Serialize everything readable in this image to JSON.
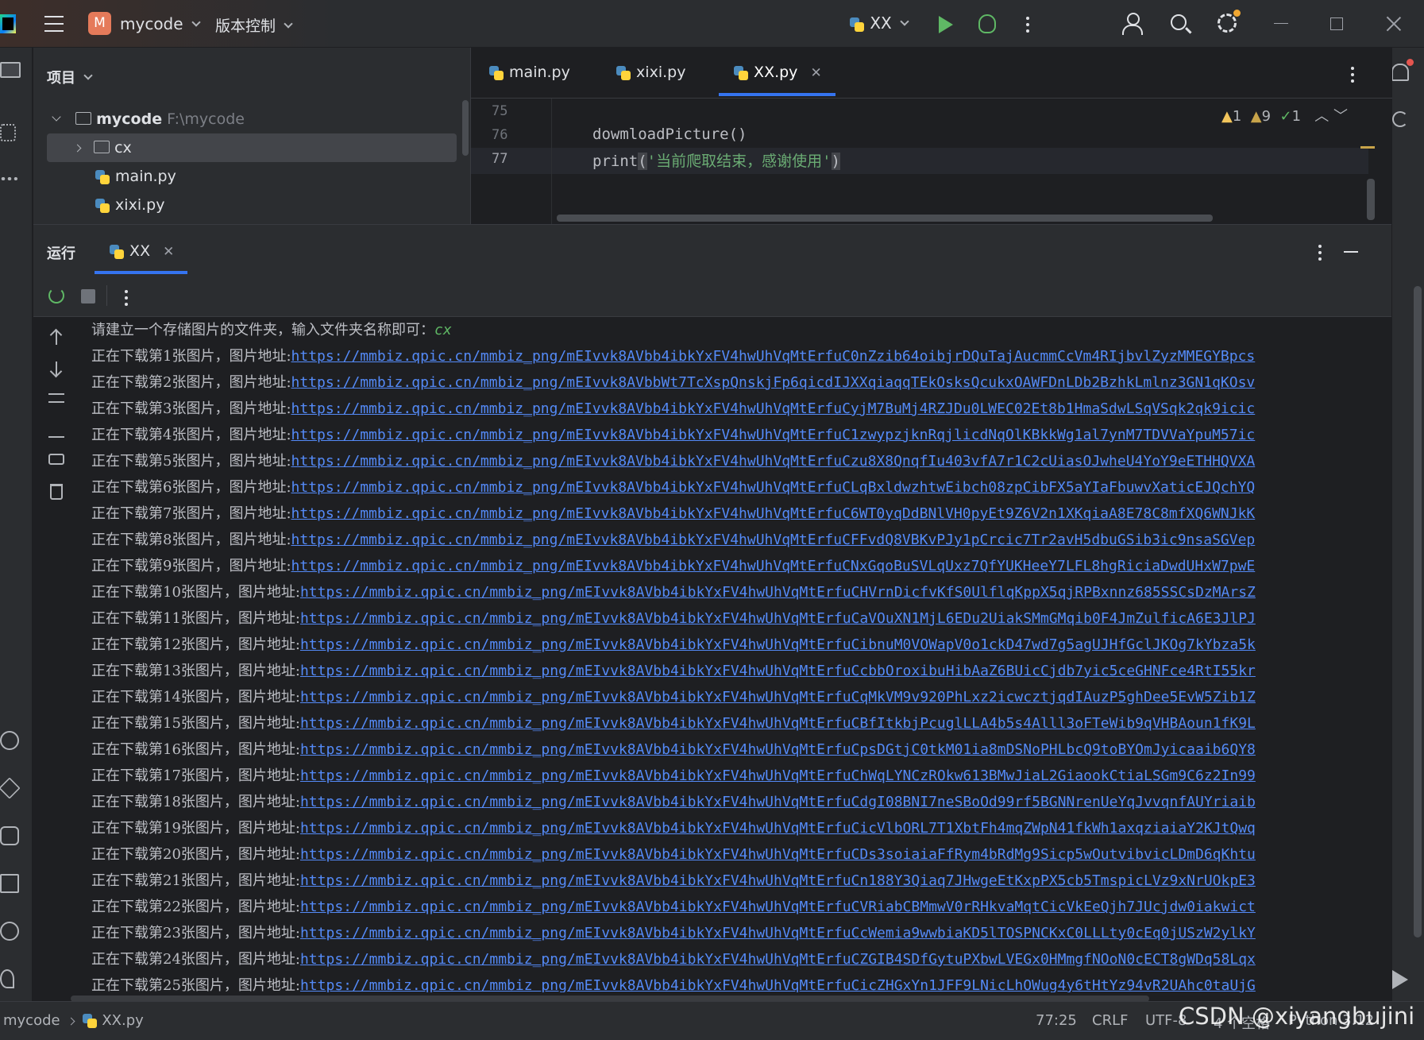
{
  "titlebar": {
    "project_initial": "M",
    "project_name": "mycode",
    "vcs_label": "版本控制",
    "run_config": "XX"
  },
  "project_panel": {
    "title": "项目",
    "root": {
      "name": "mycode",
      "path": "F:\\mycode"
    },
    "items": [
      {
        "name": "cx",
        "type": "folder"
      },
      {
        "name": "main.py",
        "type": "python-file"
      },
      {
        "name": "xixi.py",
        "type": "python-file"
      }
    ]
  },
  "editor": {
    "tabs": [
      {
        "label": "main.py",
        "active": false
      },
      {
        "label": "xixi.py",
        "active": false
      },
      {
        "label": "XX.py",
        "active": true
      }
    ],
    "lines": [
      {
        "number": "75",
        "code": ""
      },
      {
        "number": "76",
        "code": "dowmloadPicture()"
      },
      {
        "number": "77",
        "code_fn": "print",
        "code_open": "(",
        "code_str": "'当前爬取结束，感谢使用'",
        "code_close": ")"
      }
    ],
    "inspections": {
      "warnings": "1",
      "weak_warnings": "9",
      "ok": "1"
    }
  },
  "run_panel": {
    "title": "运行",
    "tab_label": "XX",
    "prompt_text": "请建立一个存储图片的文件夹，输入文件夹名称即可：",
    "prompt_input": "cx",
    "download_lines": [
      {
        "prefix": "正在下载第1张图片，图片地址:",
        "url": "https://mmbiz.qpic.cn/mmbiz_png/mEIvvk8AVbb4ibkYxFV4hwUhVqMtErfuC0nZzib64oibjrDQuTajAucmmCcVm4RIjbvlZyzMMEGYBpcs"
      },
      {
        "prefix": "正在下载第2张图片，图片地址:",
        "url": "https://mmbiz.qpic.cn/mmbiz_png/mEIvvk8AVbbWt7TcXspQnskjFp6qicdIJXXqiaqqTEkOsksQcukxOAWFDnLDb2BzhkLmlnz3GN1qKOsv"
      },
      {
        "prefix": "正在下载第3张图片，图片地址:",
        "url": "https://mmbiz.qpic.cn/mmbiz_png/mEIvvk8AVbb4ibkYxFV4hwUhVqMtErfuCyjM7BuMj4RZJDu0LWEC02Et8b1HmaSdwLSqVSqk2qk9icic"
      },
      {
        "prefix": "正在下载第4张图片，图片地址:",
        "url": "https://mmbiz.qpic.cn/mmbiz_png/mEIvvk8AVbb4ibkYxFV4hwUhVqMtErfuC1zwypzjknRqjlicdNqOlKBkkWg1al7ynM7TDVVaYpuM57ic"
      },
      {
        "prefix": "正在下载第5张图片，图片地址:",
        "url": "https://mmbiz.qpic.cn/mmbiz_png/mEIvvk8AVbb4ibkYxFV4hwUhVqMtErfuCzu8X8QnqfIu403vfA7r1C2cUiasOJwheU4YoY9eETHHQVXA"
      },
      {
        "prefix": "正在下载第6张图片，图片地址:",
        "url": "https://mmbiz.qpic.cn/mmbiz_png/mEIvvk8AVbb4ibkYxFV4hwUhVqMtErfuCLqBxldwzhtwEibch08zpCibFX5aYIaFbuwvXaticEJQchYQ"
      },
      {
        "prefix": "正在下载第7张图片，图片地址:",
        "url": "https://mmbiz.qpic.cn/mmbiz_png/mEIvvk8AVbb4ibkYxFV4hwUhVqMtErfuC6WT0yqDdBNlVH0pyEt9Z6V2n1XKqiaA8E78C8mfXQ6WNJkK"
      },
      {
        "prefix": "正在下载第8张图片，图片地址:",
        "url": "https://mmbiz.qpic.cn/mmbiz_png/mEIvvk8AVbb4ibkYxFV4hwUhVqMtErfuCFFvdQ8VBKvPJy1pCrcic7Tr2avH5dbuGSib3ic9nsaSGVep"
      },
      {
        "prefix": "正在下载第9张图片，图片地址:",
        "url": "https://mmbiz.qpic.cn/mmbiz_png/mEIvvk8AVbb4ibkYxFV4hwUhVqMtErfuCNxGqoBuSVLqUxz7QfYUKHeeY7LFL8hgRiciaDwdUHxW7pwE"
      },
      {
        "prefix": "正在下载第10张图片，图片地址:",
        "url": "https://mmbiz.qpic.cn/mmbiz_png/mEIvvk8AVbb4ibkYxFV4hwUhVqMtErfuCHVrnDicfvKfS0UlflqKppX5qjRPBxnnz685SSCsDzMArsZ"
      },
      {
        "prefix": "正在下载第11张图片，图片地址:",
        "url": "https://mmbiz.qpic.cn/mmbiz_png/mEIvvk8AVbb4ibkYxFV4hwUhVqMtErfuCaVOuXN1MjL6EDu2UiakSMmGMqib0F4JmZulficA6E3JlPJ"
      },
      {
        "prefix": "正在下载第12张图片，图片地址:",
        "url": "https://mmbiz.qpic.cn/mmbiz_png/mEIvvk8AVbb4ibkYxFV4hwUhVqMtErfuCibnuM0VOWapV0o1ckD47wd7g5agUJHfGclJKOg7kYbza5k"
      },
      {
        "prefix": "正在下载第13张图片，图片地址:",
        "url": "https://mmbiz.qpic.cn/mmbiz_png/mEIvvk8AVbb4ibkYxFV4hwUhVqMtErfuCcbbOroxibuHibAaZ6BUicCjdb7yic5ceGHNFce4RtI55kr"
      },
      {
        "prefix": "正在下载第14张图片，图片地址:",
        "url": "https://mmbiz.qpic.cn/mmbiz_png/mEIvvk8AVbb4ibkYxFV4hwUhVqMtErfuCqMkVM9v920PhLxz2icwcztjqdIAuzP5ghDee5EvW5Zib1Z"
      },
      {
        "prefix": "正在下载第15张图片，图片地址:",
        "url": "https://mmbiz.qpic.cn/mmbiz_png/mEIvvk8AVbb4ibkYxFV4hwUhVqMtErfuCBfItkbjPcuglLLA4b5s4Alll3oFTeWib9qVHBAoun1fK9L"
      },
      {
        "prefix": "正在下载第16张图片，图片地址:",
        "url": "https://mmbiz.qpic.cn/mmbiz_png/mEIvvk8AVbb4ibkYxFV4hwUhVqMtErfuCpsDGtjC0tkM01ia8mDSNoPHLbcQ9toBYOmJyicaaib6QY8"
      },
      {
        "prefix": "正在下载第17张图片，图片地址:",
        "url": "https://mmbiz.qpic.cn/mmbiz_png/mEIvvk8AVbb4ibkYxFV4hwUhVqMtErfuChWqLYNCzROkw613BMwJiaL2GiaookCtiaLSGm9C6z2In99"
      },
      {
        "prefix": "正在下载第18张图片，图片地址:",
        "url": "https://mmbiz.qpic.cn/mmbiz_png/mEIvvk8AVbb4ibkYxFV4hwUhVqMtErfuCdgI08BNI7neSBoOd99rf5BGNNrenUeYqJvvqnfAUYriaib"
      },
      {
        "prefix": "正在下载第19张图片，图片地址:",
        "url": "https://mmbiz.qpic.cn/mmbiz_png/mEIvvk8AVbb4ibkYxFV4hwUhVqMtErfuCicVlbORL7T1XbtFh4mqZWpN41fkWh1axqziaiaY2KJtQwq"
      },
      {
        "prefix": "正在下载第20张图片，图片地址:",
        "url": "https://mmbiz.qpic.cn/mmbiz_png/mEIvvk8AVbb4ibkYxFV4hwUhVqMtErfuCDs3soiaiaFfRym4bRdMg9Sicp5wOutvibvicLDmD6qKhtu"
      },
      {
        "prefix": "正在下载第21张图片，图片地址:",
        "url": "https://mmbiz.qpic.cn/mmbiz_png/mEIvvk8AVbb4ibkYxFV4hwUhVqMtErfuCn188Y3Qiaq7JHwgeEtKxpPX5cb5TmspicLVz9xNrUOkpE3"
      },
      {
        "prefix": "正在下载第22张图片，图片地址:",
        "url": "https://mmbiz.qpic.cn/mmbiz_png/mEIvvk8AVbb4ibkYxFV4hwUhVqMtErfuCVRiabCBMmwV0rRHkvaMqtCicVkEeQjh7JUcjdw0iakwict"
      },
      {
        "prefix": "正在下载第23张图片，图片地址:",
        "url": "https://mmbiz.qpic.cn/mmbiz_png/mEIvvk8AVbb4ibkYxFV4hwUhVqMtErfuCcWemia9wwbiaKD5lTOSPNCKxC0LLLty0cEq0jUSzW2ylkY"
      },
      {
        "prefix": "正在下载第24张图片，图片地址:",
        "url": "https://mmbiz.qpic.cn/mmbiz_png/mEIvvk8AVbb4ibkYxFV4hwUhVqMtErfuCZGIB4SDfGytuPXbwLVEGx0HMmgfNOoN0cECT8gWDq58Lqx"
      },
      {
        "prefix": "正在下载第25张图片，图片地址:",
        "url": "https://mmbiz.qpic.cn/mmbiz_png/mEIvvk8AVbb4ibkYxFV4hwUhVqMtErfuCicZHGxYn1JFF9LNicLhOWug4y6tHtYz94vR2UAhc0taUjG"
      }
    ]
  },
  "statusbar": {
    "project": "mycode",
    "file": "XX.py",
    "position": "77:25",
    "line_ending": "CRLF",
    "encoding": "UTF-8",
    "indent": "4 个空格",
    "interpreter": "Python 3.12"
  },
  "watermark": "CSDN @xiyangbujini",
  "colors": {
    "background": "#1e1f22",
    "panel": "#2b2d30",
    "accent": "#3574f0",
    "link": "#548af7",
    "run_green": "#5fb865",
    "string_green": "#6aab73",
    "warning": "#f2c55c",
    "project_badge": "#e57a5a"
  }
}
